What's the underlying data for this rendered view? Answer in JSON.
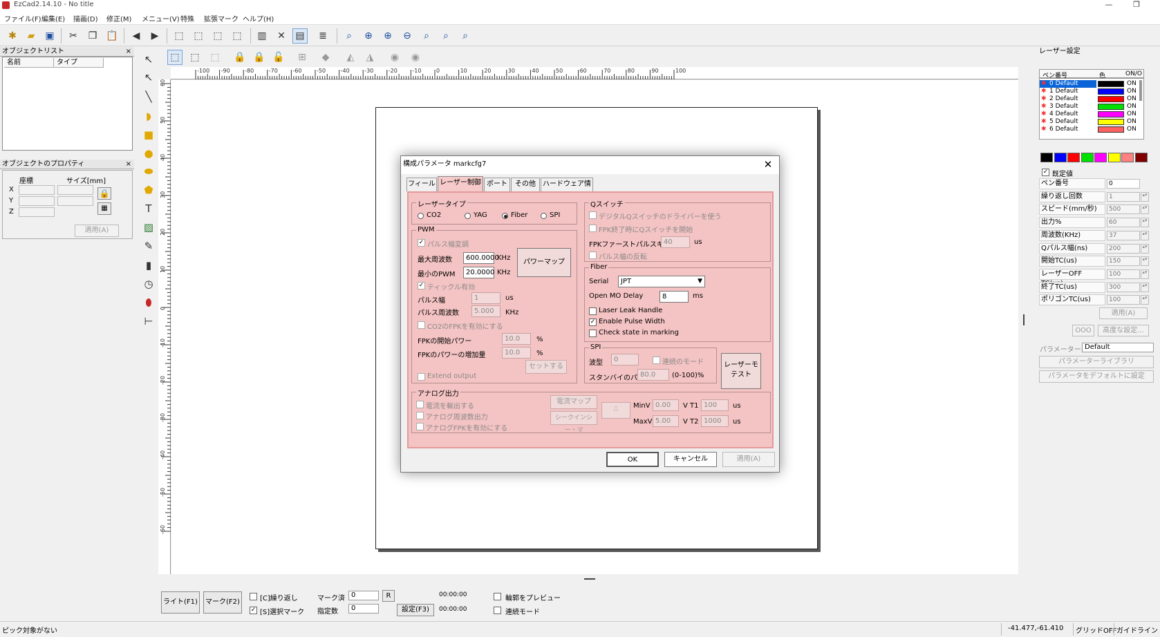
{
  "window": {
    "title": "EzCad2.14.10 - No title",
    "minimize_glyph": "—",
    "maximize_glyph": "❐"
  },
  "menu": [
    "ファイル(F)",
    "編集(E)",
    "描画(D)",
    "修正(M)",
    "メニュー(V)",
    "特殊",
    "拡張マーク",
    "ヘルプ(H)"
  ],
  "toolbar_icons": [
    "new-icon",
    "open-icon",
    "save-icon",
    "cut-icon",
    "copy-icon",
    "paste-icon",
    "undo-icon",
    "redo-icon",
    "select-icon",
    "select-partial-icon",
    "select-group-icon",
    "select-add-icon",
    "hatch-icon",
    "tools-icon",
    "parameters-icon",
    "object-list-icon",
    "zoom-icon",
    "zoom-in-icon",
    "zoom-out-icon",
    "zoom-window-icon",
    "zoom-all-icon",
    "zoom-fit-icon",
    "zoom-select-icon"
  ],
  "object_list": {
    "title": "オブジェクトリスト",
    "close": "×",
    "col_name": "名前",
    "col_type": "タイプ"
  },
  "properties": {
    "title": "オブジェクトのプロパティ",
    "close": "×",
    "coord_label": "座標",
    "size_label": "サイズ[mm]",
    "x": "X",
    "y": "Y",
    "z": "Z",
    "apply": "適用(A)"
  },
  "ruler": {
    "h_labels": [
      "-100",
      "-90",
      "-80",
      "-70",
      "-60",
      "-50",
      "-40",
      "-30",
      "-20",
      "-10",
      "0",
      "10",
      "20",
      "30",
      "40",
      "50",
      "60",
      "70",
      "80",
      "90",
      "100"
    ],
    "v_labels": [
      "60",
      "50",
      "40",
      "30",
      "20",
      "10",
      "0",
      "-10",
      "-20",
      "-30",
      "-40",
      "-50",
      "-60"
    ]
  },
  "bottom": {
    "light_btn": "ライト(F1)",
    "mark_btn": "マーク(F2)",
    "repeat_label": "[C]繰り返し",
    "select_mark_label": "[S]選択マーク",
    "marked_label": "マーク済",
    "marked_value": "0",
    "r_btn": "R",
    "specified_label": "指定数",
    "specified_value": "0",
    "time1": "00:00:00",
    "time2": "00:00:00",
    "param_btn": "設定(F3)",
    "preview_label": "輪郭をプレビュー",
    "continuous_label": "連続モード"
  },
  "status": {
    "message": "ピック対象がない",
    "coords": "-41.477,-61.410",
    "grid": "グリッドOFF",
    "guide": "ガイドライン"
  },
  "laser_settings": {
    "title": "レーザー設定",
    "col_pen": "ペン番号",
    "col_color": "色",
    "col_onoff": "ON/O",
    "pens": [
      {
        "no": "0 Default",
        "color": "#000000",
        "state": "ON"
      },
      {
        "no": "1 Default",
        "color": "#0000ff",
        "state": "ON"
      },
      {
        "no": "2 Default",
        "color": "#ff0000",
        "state": "ON"
      },
      {
        "no": "3 Default",
        "color": "#00e000",
        "state": "ON"
      },
      {
        "no": "4 Default",
        "color": "#ff00ff",
        "state": "ON"
      },
      {
        "no": "5 Default",
        "color": "#ffff00",
        "state": "ON"
      },
      {
        "no": "6 Default",
        "color": "#ff6060",
        "state": "ON"
      }
    ],
    "palette": [
      "#000000",
      "#0000ff",
      "#ff0000",
      "#00e000",
      "#ff00ff",
      "#ffff00",
      "#ff8080",
      "#800000"
    ],
    "default_label": "既定値",
    "params": [
      {
        "label": "ペン番号",
        "value": "0"
      },
      {
        "label": "繰り返し回数",
        "value": "1"
      },
      {
        "label": "スピード(mm/秒)",
        "value": "500"
      },
      {
        "label": "出力%",
        "value": "60"
      },
      {
        "label": "周波数(KHz)",
        "value": "37"
      },
      {
        "label": "Qパルス幅(ns)",
        "value": "200"
      },
      {
        "label": "開始TC(us)",
        "value": "150"
      },
      {
        "label": "レーザーOFF TC(us)",
        "value": "100"
      },
      {
        "label": "終了TC(us)",
        "value": "300"
      },
      {
        "label": "ポリゴンTC(us)",
        "value": "100"
      }
    ],
    "apply": "適用(A)",
    "small_btn": "OOO",
    "advanced": "高度な設定...",
    "param_name_label": "パラメーター名",
    "param_name_value": "Default",
    "library_btn": "パラメーターライブラリ",
    "set_default_btn": "パラメータをデフォルトに設定"
  },
  "dialog": {
    "title": "構成パラメータ markcfg7",
    "close": "✕",
    "tabs": [
      "フィールド",
      "レーザー制御",
      "ポート",
      "その他",
      "ハードウェア情報"
    ],
    "laser_type": {
      "title": "レーザータイプ",
      "options": [
        "CO2",
        "YAG",
        "Fiber",
        "SPI"
      ],
      "selected": "Fiber"
    },
    "pwm": {
      "title": "PWM",
      "pulse_mod": "パルス幅変調",
      "max_freq_label": "最大周波数",
      "max_freq_value": "600.0000",
      "max_freq_unit": "KHz",
      "min_pwm_label": "最小のPWM",
      "min_pwm_value": "20.0000",
      "min_pwm_unit": "KHz",
      "power_map": "パワーマップ",
      "tickle": "ティックル有効",
      "pulse_width_label": "パルス幅",
      "pulse_width_value": "1",
      "pulse_width_unit": "us",
      "pulse_freq_label": "パルス周波数",
      "pulse_freq_value": "5.000",
      "pulse_freq_unit": "KHz",
      "co2_fpk": "CO2のFPKを有効にする",
      "fpk_start_label": "FPKの開始パワー",
      "fpk_start_value": "10.0",
      "fpk_start_unit": "%",
      "fpk_inc_label": "FPKのパワーの増加量",
      "fpk_inc_value": "10.0",
      "fpk_inc_unit": "%",
      "set_btn": "セットする",
      "extend": "Extend output"
    },
    "qswitch": {
      "title": "Qスイッチ",
      "digital": "デジタルQスイッチのドライバーを使う",
      "fpk_end": "FPK終了時にQスイッチを開始",
      "fpk_killer_label": "FPKファーストパルスキラー",
      "fpk_killer_value": "40",
      "fpk_killer_unit": "us",
      "invert": "パルス幅の反転"
    },
    "fiber": {
      "title": "Fiber",
      "serial_label": "Serial",
      "serial_value": "JPT",
      "mo_delay_label": "Open MO Delay",
      "mo_delay_value": "8",
      "mo_delay_unit": "ms",
      "leak": "Laser Leak Handle",
      "pulse_width": "Enable Pulse Width",
      "check_state": "Check state in marking"
    },
    "spi": {
      "title": "SPI",
      "wave_label": "波型",
      "wave_value": "0",
      "continuous": "連続のモード",
      "standby_label": "スタンバイのパ",
      "standby_value": "80.0",
      "standby_unit": "(0-100)%",
      "test_btn": "レーザーモテスト"
    },
    "analog": {
      "title": "アナログ出力",
      "current": "電流を輸出する",
      "analog_freq": "アナログ周波数出力",
      "analog_fpk": "アナログFPKを有効にする",
      "current_map": "電流マップ",
      "sequence": "シークインシー・マ",
      "minv_label": "MinV",
      "minv_value": "0.00",
      "v_label": "V",
      "maxv_label": "MaxV",
      "maxv_value": "5.00",
      "t1_label": "T1",
      "t1_value": "100",
      "t1_unit": "us",
      "t2_label": "T2",
      "t2_value": "1000",
      "t2_unit": "us"
    },
    "ok": "OK",
    "cancel": "キャンセル",
    "apply": "適用(A)"
  }
}
